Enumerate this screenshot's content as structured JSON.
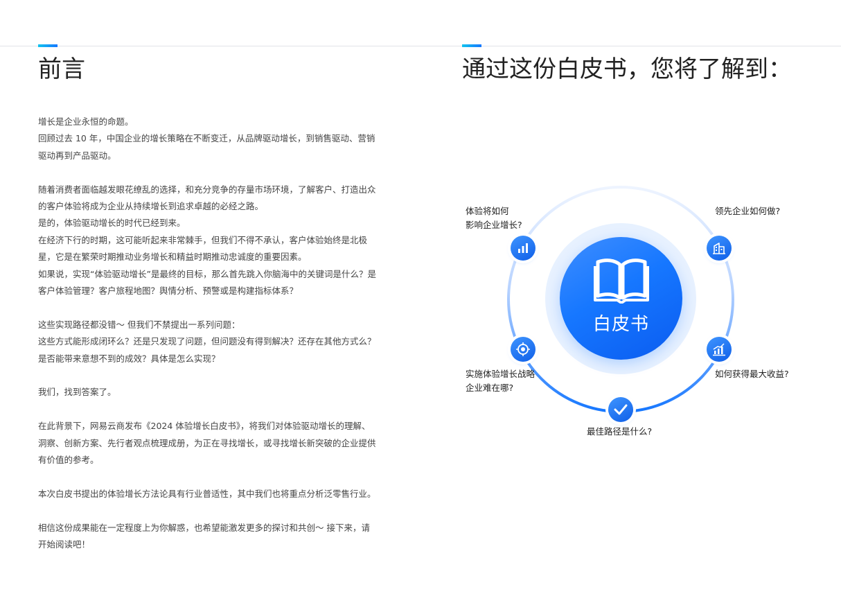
{
  "left": {
    "title": "前言",
    "paragraphs": [
      "增长是企业永恒的命题。",
      "回顾过去 10 年，中国企业的增长策略在不断变迁，从品牌驱动增长，到销售驱动、营销驱动再到产品驱动。",
      "",
      "随着消费者面临越发眼花缭乱的选择，和充分竞争的存量市场环境，了解客户、打造出众的客户体验将成为企业从持续增长到追求卓越的必经之路。",
      "是的，体验驱动增长的时代已经到来。",
      "在经济下行的时期，这可能听起来非常棘手，但我们不得不承认，客户体验始终是北极星，它是在繁荣时期推动业务增长和精益时期推动忠诚度的重要因素。",
      "如果说，实现“体验驱动增长”是最终的目标，那么首先跳入你脑海中的关键词是什么？是客户体验管理？客户旅程地图？舆情分析、预警或是构建指标体系？",
      "",
      "这些实现路径都没错～ 但我们不禁提出一系列问题：",
      "这些方式能形成闭环么？还是只发现了问题，但问题没有得到解决？还存在其他方式么？是否能带来意想不到的成效？具体是怎么实现？",
      "",
      "我们，找到答案了。",
      "",
      "在此背景下，网易云商发布《2024 体验增长白皮书》，将我们对体验驱动增长的理解、洞察、创新方案、先行者观点梳理成册，为正在寻找增长，或寻找增长新突破的企业提供有价值的参考。",
      "",
      "本次白皮书提出的体验增长方法论具有行业普适性，其中我们也将重点分析泛零售行业。",
      "",
      "相信这份成果能在一定程度上为你解惑，也希望能激发更多的探讨和共创～ 接下来，请开始阅读吧！"
    ]
  },
  "right": {
    "title": "通过这份白皮书，您将了解到：",
    "center_label": "白皮书",
    "questions": {
      "top_left_line1": "体验将如何",
      "top_left_line2": "影响企业增长?",
      "top_right": "领先企业如何做?",
      "bottom_left_line1": "实施体验增长战略",
      "bottom_left_line2": "企业难在哪?",
      "bottom_right": "如何获得最大收益?",
      "bottom": "最佳路径是什么?"
    }
  },
  "colors": {
    "accent_blue": "#1677ff",
    "accent_cyan": "#12c4ee",
    "halo": "#e7f1ff",
    "text": "#222222"
  },
  "icons": [
    "bar-chart-icon",
    "building-icon",
    "target-icon",
    "growth-chart-icon",
    "checkmark-icon",
    "open-book-icon"
  ]
}
